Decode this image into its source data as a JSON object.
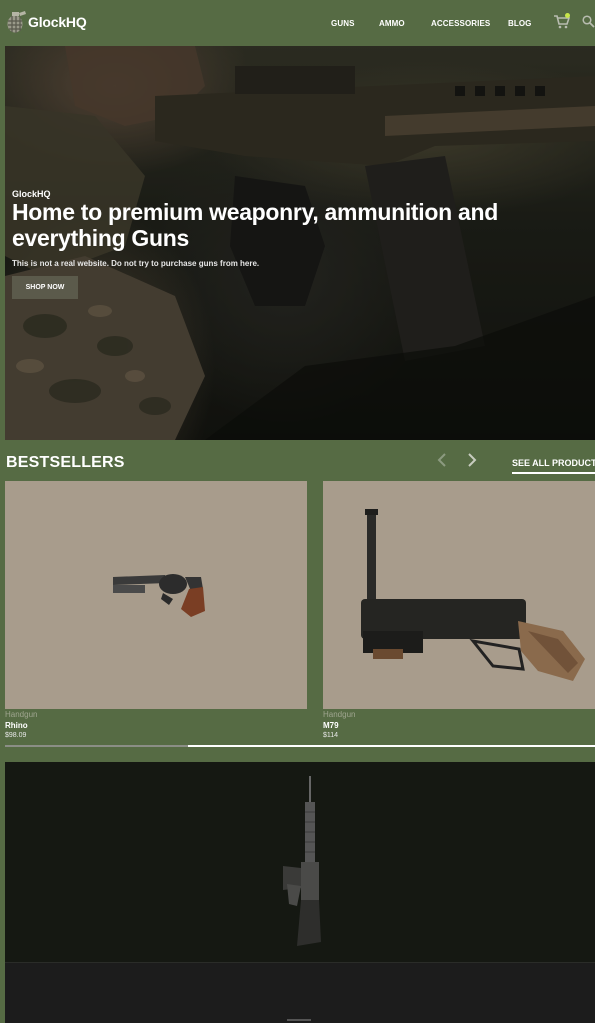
{
  "header": {
    "brand": "GlockHQ",
    "nav": [
      "GUNS",
      "AMMO",
      "ACCESSORIES",
      "BLOG"
    ],
    "icons": {
      "logo": "grenade-icon",
      "cart": "cart-icon",
      "search": "search-icon"
    },
    "colors": {
      "background": "#566b44",
      "cart_badge": "#c8e64a"
    }
  },
  "hero": {
    "eyebrow": "GlockHQ",
    "title": "Home to premium weaponry, ammunition and everything Guns",
    "subtitle": "This is not a real website. Do not try to purchase guns from here.",
    "cta": "SHOP NOW"
  },
  "bestsellers": {
    "title": "BESTSELLERS",
    "see_all": "SEE ALL PRODUCTS",
    "prev_icon": "chevron-left-icon",
    "next_icon": "chevron-right-icon",
    "products": [
      {
        "category": "Handgun",
        "name": "Rhino",
        "price": "$98.09",
        "image": "revolver-image"
      },
      {
        "category": "Handgun",
        "name": "M79",
        "price": "$114",
        "image": "grenade-launcher-image"
      }
    ],
    "scroll_progress": 0.31
  },
  "feature": {
    "image": "rifle-image"
  }
}
